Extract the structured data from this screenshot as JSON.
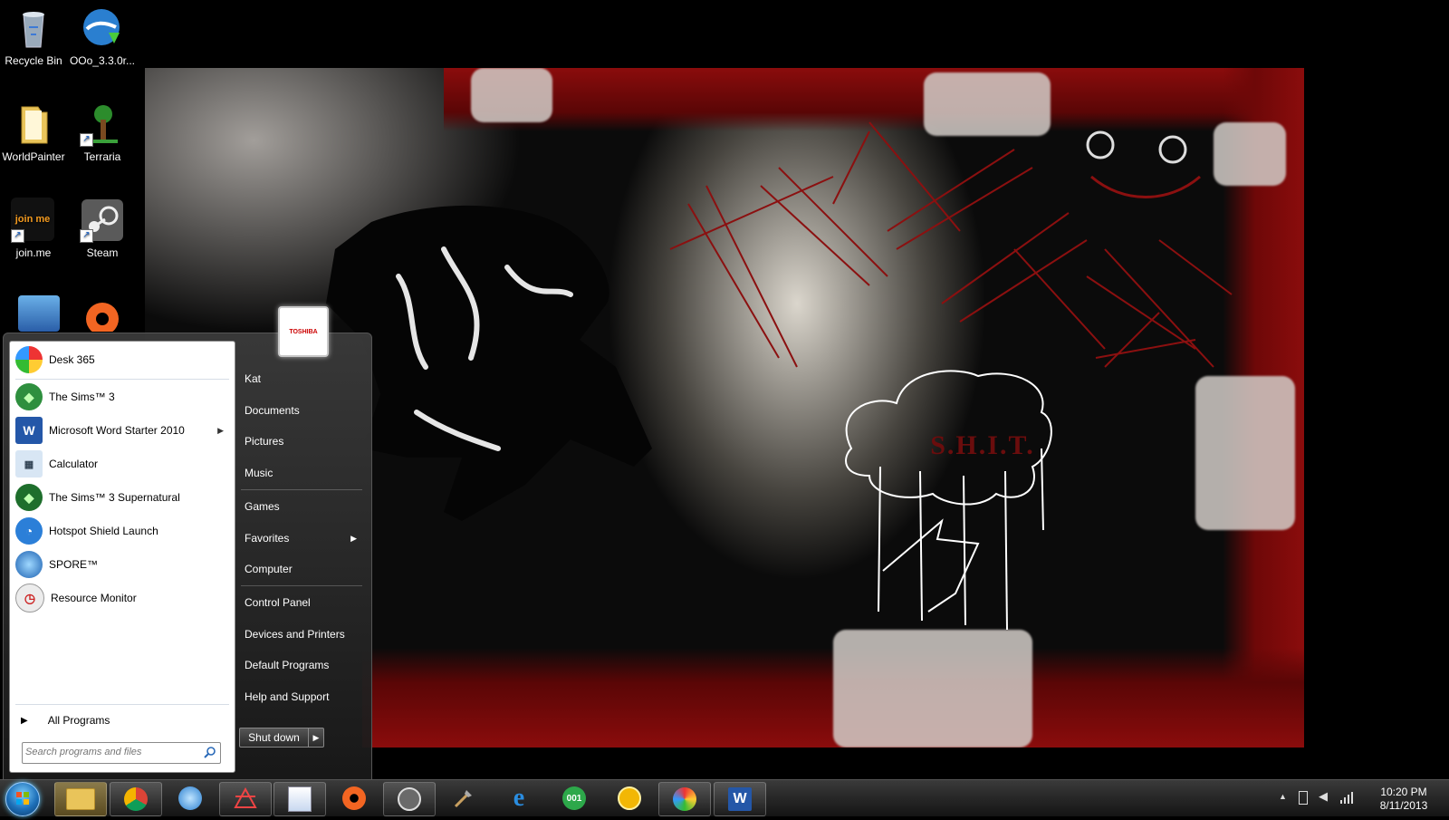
{
  "desktop": {
    "icons": [
      {
        "label": "Recycle Bin"
      },
      {
        "label": "OOo_3.3.0r..."
      },
      {
        "label": "WorldPainter"
      },
      {
        "label": "Terraria"
      },
      {
        "label": "join.me"
      },
      {
        "label": "Steam"
      }
    ],
    "joinme_logo": "join me"
  },
  "wallpaper": {
    "label": "S.H.I.T.",
    "colors": {
      "blood": "#8b0c0c",
      "dark": "#0b0b0b"
    }
  },
  "start_menu": {
    "programs": [
      {
        "label": "Desk 365",
        "icon": "desk365-icon"
      },
      {
        "label": "The Sims™ 3",
        "icon": "sims3-icon"
      },
      {
        "label": "Microsoft Word Starter 2010",
        "icon": "word-icon",
        "has_submenu": true
      },
      {
        "label": "Calculator",
        "icon": "calculator-icon"
      },
      {
        "label": "The Sims™ 3 Supernatural",
        "icon": "sims3-supernatural-icon"
      },
      {
        "label": "Hotspot Shield Launch",
        "icon": "hotspot-shield-icon"
      },
      {
        "label": "SPORE™",
        "icon": "spore-icon"
      },
      {
        "label": "Resource Monitor",
        "icon": "resource-monitor-icon"
      }
    ],
    "all_programs": "All Programs",
    "search_placeholder": "Search programs and files",
    "user_picture_text": "TOSHIBA",
    "right_items": [
      {
        "label": "Kat"
      },
      {
        "label": "Documents"
      },
      {
        "label": "Pictures"
      },
      {
        "label": "Music"
      },
      {
        "label": "Games"
      },
      {
        "label": "Favorites",
        "has_submenu": true
      },
      {
        "label": "Computer"
      },
      {
        "label": "Control Panel"
      },
      {
        "label": "Devices and Printers"
      },
      {
        "label": "Default Programs"
      },
      {
        "label": "Help and Support"
      }
    ],
    "shutdown_label": "Shut down"
  },
  "taskbar": {
    "pinned": [
      "windows-explorer-icon",
      "chrome-icon",
      "openoffice-icon",
      "pixel-app-icon",
      "paint-icon",
      "origin-icon",
      "steam-icon",
      "worldpainter-shovel-icon",
      "internet-explorer-icon",
      "001-app-icon",
      "search-app-icon",
      "paint-palette-icon",
      "word-icon"
    ],
    "app_001_text": "001",
    "word_letter": "W",
    "clock": {
      "time": "10:20 PM",
      "date": "8/11/2013"
    }
  }
}
